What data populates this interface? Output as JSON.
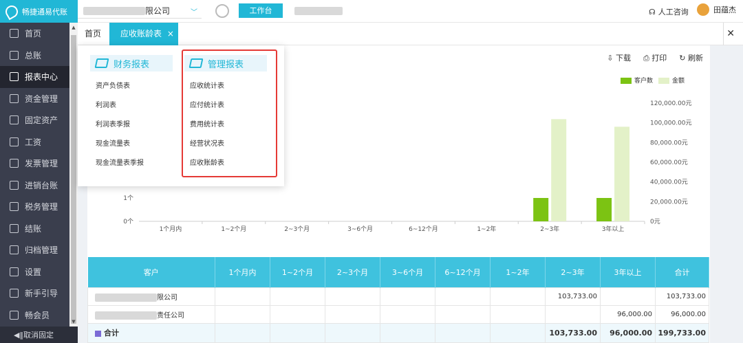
{
  "app": {
    "logo_text": "畅捷通易代账"
  },
  "sidebar": {
    "items": [
      {
        "label": "首页",
        "icon": "home-icon"
      },
      {
        "label": "总账",
        "icon": "ledger-icon"
      },
      {
        "label": "报表中心",
        "icon": "chart-icon",
        "active": true
      },
      {
        "label": "资金管理",
        "icon": "money-icon"
      },
      {
        "label": "固定资产",
        "icon": "asset-icon"
      },
      {
        "label": "工资",
        "icon": "salary-icon"
      },
      {
        "label": "发票管理",
        "icon": "invoice-icon"
      },
      {
        "label": "进销台账",
        "icon": "inventory-icon"
      },
      {
        "label": "税务管理",
        "icon": "tax-icon"
      },
      {
        "label": "结账",
        "icon": "close-account-icon"
      },
      {
        "label": "归档管理",
        "icon": "archive-icon"
      },
      {
        "label": "设置",
        "icon": "gear-icon"
      },
      {
        "label": "新手引导",
        "icon": "guide-icon"
      },
      {
        "label": "畅会员",
        "icon": "vip-icon"
      }
    ],
    "unpin_label": "◀‖取消固定"
  },
  "topbar": {
    "company_suffix": "限公司",
    "workbench_label": "工作台",
    "consult_label": "人工咨询",
    "user_name": "田蕴杰"
  },
  "tabs": [
    {
      "label": "首页"
    },
    {
      "label": "应收账龄表",
      "active": true
    }
  ],
  "actions": {
    "download": "下载",
    "print": "打印",
    "refresh": "刷新"
  },
  "menu": {
    "financial": {
      "title": "财务报表",
      "items": [
        "资产负债表",
        "利润表",
        "利润表季报",
        "现金流量表",
        "现金流量表季报"
      ]
    },
    "management": {
      "title": "管理报表",
      "items": [
        "应收统计表",
        "应付统计表",
        "费用统计表",
        "经营状况表",
        "应收账龄表"
      ]
    }
  },
  "chart_data": {
    "type": "bar",
    "categories": [
      "1个月内",
      "1~2个月",
      "2~3个月",
      "3~6个月",
      "6~12个月",
      "1~2年",
      "2~3年",
      "3年以上"
    ],
    "series": [
      {
        "name": "客户数",
        "values": [
          0,
          0,
          0,
          0,
          0,
          0,
          1,
          1
        ],
        "color": "#7cc313",
        "axis": "left"
      },
      {
        "name": "金额",
        "values": [
          0,
          0,
          0,
          0,
          0,
          0,
          103733.0,
          96000.0
        ],
        "color": "#e3f1c8",
        "axis": "right"
      }
    ],
    "left_ticks": [
      "0个",
      "1个"
    ],
    "right_ticks": [
      "0元",
      "20,000.00元",
      "40,000.00元",
      "60,000.00元",
      "80,000.00元",
      "100,000.00元",
      "120,000.00元"
    ],
    "right_ylim": [
      0,
      120000
    ],
    "legend_position": "top-right"
  },
  "table": {
    "headers": [
      "客户",
      "1个月内",
      "1~2个月",
      "2~3个月",
      "3~6个月",
      "6~12个月",
      "1~2年",
      "2~3年",
      "3年以上",
      "合计"
    ],
    "rows": [
      {
        "name_suffix": "限公司",
        "cells": [
          "",
          "",
          "",
          "",
          "",
          "",
          "103,733.00",
          "",
          "103,733.00"
        ]
      },
      {
        "name_suffix": "责任公司",
        "cells": [
          "",
          "",
          "",
          "",
          "",
          "",
          "",
          "96,000.00",
          "96,000.00"
        ]
      }
    ],
    "total": {
      "label": "合计",
      "cells": [
        "",
        "",
        "",
        "",
        "",
        "",
        "103,733.00",
        "96,000.00",
        "199,733.00"
      ]
    }
  },
  "colors": {
    "accent": "#21b7d6",
    "sidebar": "#3a3e4d",
    "highlight": "#e53935"
  }
}
